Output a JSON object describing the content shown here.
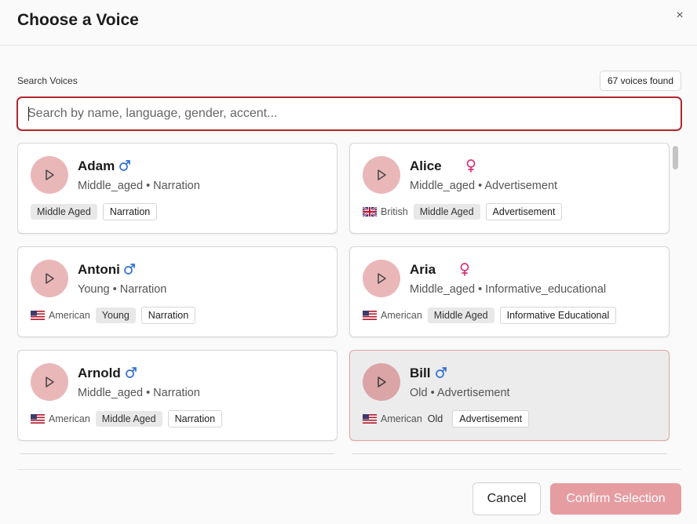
{
  "dialog": {
    "title": "Choose a Voice",
    "close_label": "×"
  },
  "search": {
    "label": "Search Voices",
    "placeholder": "Search by name, language, gender, accent...",
    "value": "",
    "count_text": "67 voices found"
  },
  "colors": {
    "accent": "#b2262d",
    "play_button": "#eab7b9",
    "male_icon": "#2f6fd6",
    "female_icon": "#d6337b",
    "confirm_button": "#e59da1"
  },
  "voices": [
    {
      "name": "Adam",
      "gender": "male",
      "meta": "Middle_aged • Narration",
      "accent": "",
      "flag": "",
      "age_tag": "Middle Aged",
      "use_tag": "Narration",
      "selected": false
    },
    {
      "name": "Alice",
      "gender": "female",
      "meta": "Middle_aged • Advertisement",
      "accent": "British",
      "flag": "uk",
      "age_tag": "Middle Aged",
      "use_tag": "Advertisement",
      "selected": false
    },
    {
      "name": "Antoni",
      "gender": "male",
      "meta": "Young • Narration",
      "accent": "American",
      "flag": "us",
      "age_tag": "Young",
      "use_tag": "Narration",
      "selected": false
    },
    {
      "name": "Aria",
      "gender": "female",
      "meta": "Middle_aged • Informative_educational",
      "accent": "American",
      "flag": "us",
      "age_tag": "Middle Aged",
      "use_tag": "Informative Educational",
      "selected": false
    },
    {
      "name": "Arnold",
      "gender": "male",
      "meta": "Middle_aged • Narration",
      "accent": "American",
      "flag": "us",
      "age_tag": "Middle Aged",
      "use_tag": "Narration",
      "selected": false
    },
    {
      "name": "Bill",
      "gender": "male",
      "meta": "Old • Advertisement",
      "accent": "American",
      "flag": "us",
      "age_tag": "Old",
      "use_tag": "Advertisement",
      "selected": true
    }
  ],
  "footer": {
    "cancel_label": "Cancel",
    "confirm_label": "Confirm Selection"
  }
}
